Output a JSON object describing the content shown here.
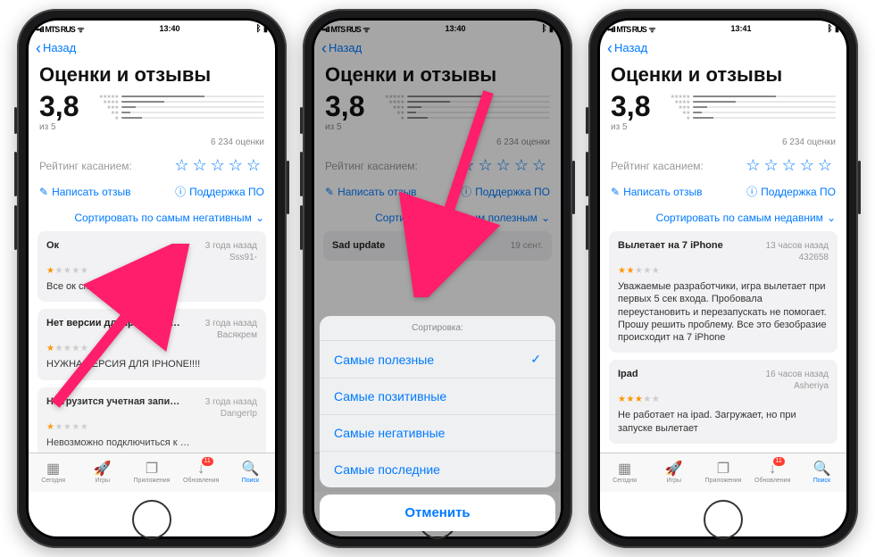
{
  "status": {
    "carrier": "MTS RUS",
    "wifi": "ᯤ",
    "bt": "ᛒ",
    "batt": "▮"
  },
  "times": [
    "13:40",
    "13:40",
    "13:41"
  ],
  "nav_back": "Назад",
  "title": "Оценки и отзывы",
  "rating": "3,8",
  "of5": "из 5",
  "count": "6 234 оценки",
  "bars": [
    58,
    30,
    10,
    6,
    14
  ],
  "tap": "Рейтинг касанием:",
  "write": "Написать отзыв",
  "support": "Поддержка ПО",
  "sorts": [
    "Сортировать по самым негативным",
    "Сортировать л самым полезным",
    "Сортировать по самым недавним"
  ],
  "sheet": {
    "title": "Сортировка:",
    "options": [
      "Самые полезные",
      "Самые позитивные",
      "Самые негативные",
      "Самые последние"
    ],
    "selected": 0,
    "cancel": "Отменить",
    "peek_title": "Sad update",
    "peek_date": "19 сент."
  },
  "reviews_left": [
    {
      "title": "Ок",
      "time": "3 года назад",
      "user": "Sss91-",
      "stars": 1,
      "body": "Все ок спасибо👍"
    },
    {
      "title": "Нет версии для Iphone! НУЖ…",
      "time": "3 года назад",
      "user": "Васякрем",
      "stars": 1,
      "body": "НУЖНА ВЕРСИЯ ДЛЯ IPHONE!!!!"
    },
    {
      "title": "Не грузится учетная запись",
      "time": "3 года назад",
      "user": "DangerIp",
      "stars": 1,
      "body": "Невозможно подключиться к …"
    }
  ],
  "reviews_right": [
    {
      "title": "Вылетает на 7 iPhone",
      "time": "13 часов назад",
      "user": "432658",
      "stars": 2,
      "body": "Уважаемые разработчики, игра вылетает при первых 5 сек входа. Пробовала переустановить и перезапускать не помогает. Прошу решить проблему. Все это безобразие происходит на 7 iPhone"
    },
    {
      "title": "Ipad",
      "time": "16 часов назад",
      "user": "Asheriya",
      "stars": 3,
      "body": "Не работает на ipad. Загружает, но при запуске вылетает"
    }
  ],
  "tabs": [
    {
      "icon": "▦",
      "label": "Сегодня"
    },
    {
      "icon": "🚀",
      "label": "Игры"
    },
    {
      "icon": "❐",
      "label": "Приложения"
    },
    {
      "icon": "↓",
      "label": "Обновления",
      "badge": "11"
    },
    {
      "icon": "🔍",
      "label": "Поиск",
      "active": true
    }
  ]
}
